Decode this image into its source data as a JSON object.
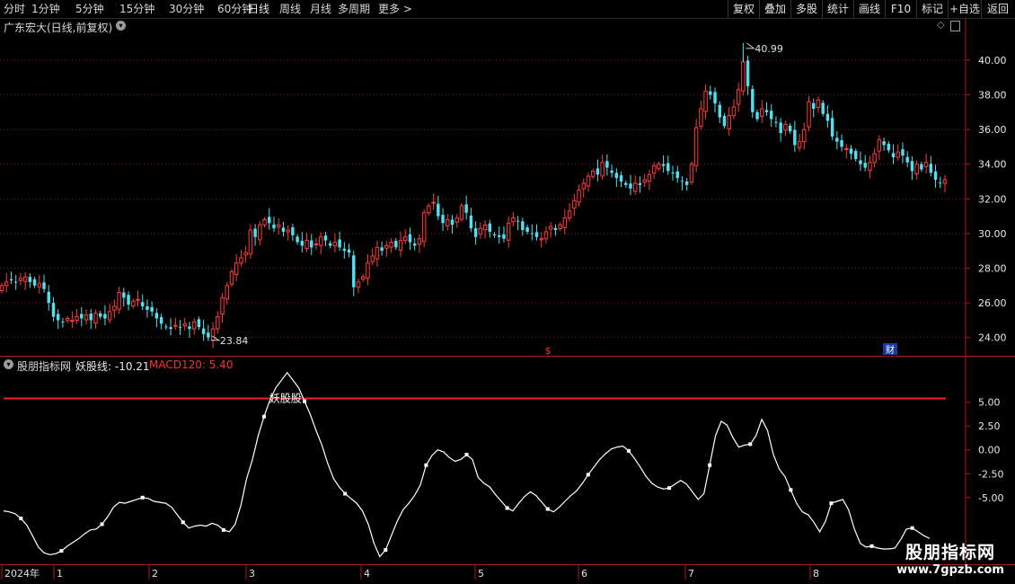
{
  "toolbar": {
    "periods": [
      "分时",
      "1分钟",
      "5分钟",
      "15分钟",
      "30分钟",
      "60分钟",
      "日线",
      "周线",
      "月线",
      "多周期",
      "更多 >"
    ],
    "active_period": "日线",
    "right_buttons": [
      "复权",
      "叠加",
      "多股",
      "统计",
      "画线",
      "F10",
      "标记",
      "+自选",
      "返回"
    ]
  },
  "main_chart": {
    "title": "广东宏大(日线,前复权)",
    "high_label": "40.99",
    "low_label": "23.84",
    "markers": [
      "$",
      "财"
    ]
  },
  "indicator": {
    "name": "股朋指标网",
    "line_label": "妖股线: -10.21",
    "macd_label": "MACD120: 5.40",
    "signal_text": "妖股股"
  },
  "watermark": {
    "title": "股朋指标网",
    "url": "www.7gpzb.com"
  },
  "colors": {
    "up": "#ff3b3b",
    "down": "#52e0f0",
    "axis": "#b01818",
    "threshold": "#ff2020",
    "line": "#ffffff"
  },
  "chart_data": [
    {
      "type": "candlestick",
      "title": "广东宏大(日线,前复权)",
      "ylim": [
        23,
        41.5
      ],
      "yticks": [
        24.0,
        26.0,
        28.0,
        30.0,
        32.0,
        34.0,
        36.0,
        38.0,
        40.0
      ],
      "ytick_labels": [
        "24.00",
        "26.00",
        "28.00",
        "30.00",
        "32.00",
        "34.00",
        "36.00",
        "38.00",
        "40.00"
      ],
      "x_labels": [
        "2024年",
        "1",
        "2",
        "3",
        "4",
        "5",
        "6",
        "7",
        "8"
      ],
      "close": [
        27.0,
        27.2,
        27.3,
        27.2,
        27.4,
        27.5,
        27.2,
        27.0,
        27.1,
        26.8,
        26.0,
        25.2,
        25.0,
        24.9,
        25.1,
        25.0,
        25.2,
        25.1,
        25.3,
        25.0,
        25.4,
        25.2,
        25.1,
        25.5,
        25.8,
        26.6,
        26.3,
        25.9,
        26.1,
        26.2,
        25.8,
        25.6,
        25.5,
        25.1,
        24.8,
        24.6,
        24.5,
        24.7,
        24.6,
        24.8,
        24.5,
        24.9,
        24.6,
        24.2,
        24.0,
        24.5,
        25.2,
        26.3,
        27.0,
        27.8,
        28.3,
        28.6,
        28.9,
        30.2,
        29.8,
        30.5,
        30.8,
        30.6,
        30.3,
        30.5,
        30.1,
        30.2,
        29.9,
        29.5,
        29.3,
        29.6,
        29.2,
        29.4,
        29.8,
        29.6,
        29.3,
        29.5,
        29.2,
        29.0,
        28.9,
        26.9,
        27.2,
        27.5,
        28.3,
        28.7,
        29.2,
        29.0,
        29.3,
        29.5,
        29.2,
        29.6,
        29.8,
        29.5,
        29.3,
        29.7,
        31.2,
        31.6,
        31.8,
        31.0,
        30.6,
        30.8,
        30.5,
        30.9,
        31.6,
        31.2,
        30.3,
        29.8,
        30.3,
        30.5,
        30.1,
        29.9,
        29.8,
        29.7,
        30.6,
        30.9,
        30.7,
        30.2,
        30.1,
        30.0,
        29.8,
        29.7,
        30.1,
        30.4,
        30.2,
        30.5,
        30.9,
        31.3,
        31.9,
        32.5,
        32.9,
        33.3,
        33.6,
        33.4,
        34.1,
        33.8,
        33.5,
        33.2,
        33.0,
        32.8,
        32.6,
        32.9,
        32.8,
        33.1,
        33.4,
        33.9,
        34.0,
        33.9,
        33.6,
        33.5,
        33.2,
        33.0,
        32.8,
        34.0,
        36.1,
        37.2,
        38.2,
        38.0,
        37.5,
        36.7,
        36.2,
        36.8,
        37.3,
        38.3,
        39.9,
        38.5,
        37.0,
        36.6,
        37.2,
        37.0,
        36.6,
        36.4,
        35.8,
        36.3,
        35.9,
        35.1,
        35.3,
        36.0,
        37.6,
        37.2,
        37.7,
        36.9,
        36.5,
        35.6,
        35.3,
        35.0,
        34.9,
        34.6,
        34.3,
        34.0,
        33.8,
        34.1,
        34.6,
        35.4,
        35.1,
        34.8,
        34.4,
        34.7,
        34.5,
        34.1,
        33.6,
        34.0,
        33.7,
        34.1,
        33.5,
        33.1,
        32.9,
        33.1
      ],
      "highs": [
        {
          "label": "40.99",
          "value": 40.99
        }
      ],
      "lows": [
        {
          "label": "23.84",
          "value": 23.84
        }
      ]
    },
    {
      "type": "line",
      "ylim": [
        -12,
        9.5
      ],
      "yticks": [
        5.0,
        2.5,
        0.0,
        -2.5,
        -5.0
      ],
      "ytick_labels": [
        "5.00",
        "2.50",
        "0.00",
        "-2.50",
        "-5.00",
        "-7.50"
      ],
      "threshold": 5.4,
      "values": [
        -6.4,
        -6.5,
        -6.7,
        -7.2,
        -7.9,
        -9.0,
        -10.2,
        -10.8,
        -11.0,
        -10.9,
        -10.6,
        -10.1,
        -9.7,
        -9.3,
        -8.8,
        -8.4,
        -8.3,
        -7.8,
        -7.0,
        -6.0,
        -5.5,
        -5.6,
        -5.4,
        -5.2,
        -5.0,
        -5.1,
        -5.4,
        -5.5,
        -5.6,
        -6.0,
        -6.8,
        -7.6,
        -8.2,
        -8.0,
        -7.9,
        -8.0,
        -7.7,
        -7.9,
        -8.4,
        -8.6,
        -7.8,
        -5.8,
        -3.0,
        -1.0,
        1.5,
        3.5,
        5.2,
        6.5,
        7.3,
        8.1,
        7.3,
        6.5,
        5.1,
        3.7,
        2.0,
        0.5,
        -1.4,
        -3.0,
        -3.9,
        -4.6,
        -5.1,
        -5.6,
        -6.4,
        -7.8,
        -9.8,
        -11.2,
        -10.5,
        -9.0,
        -7.5,
        -6.3,
        -5.6,
        -4.8,
        -3.7,
        -1.6,
        -0.6,
        0.0,
        -0.2,
        -0.8,
        -1.2,
        -1.0,
        -0.5,
        -1.0,
        -2.9,
        -3.5,
        -3.9,
        -4.7,
        -5.4,
        -6.1,
        -6.4,
        -5.6,
        -4.9,
        -4.4,
        -4.8,
        -5.5,
        -6.2,
        -6.5,
        -6.0,
        -5.4,
        -4.8,
        -4.3,
        -3.5,
        -2.6,
        -1.8,
        -1.0,
        -0.4,
        0.1,
        0.3,
        0.4,
        -0.1,
        -0.9,
        -1.8,
        -2.8,
        -3.5,
        -3.9,
        -4.1,
        -4.0,
        -3.6,
        -3.2,
        -3.6,
        -4.4,
        -5.2,
        -4.6,
        -1.6,
        1.5,
        3.0,
        2.6,
        1.3,
        0.3,
        0.5,
        0.6,
        1.5,
        3.2,
        2.0,
        -0.5,
        -2.0,
        -2.8,
        -4.2,
        -5.6,
        -6.5,
        -6.8,
        -7.6,
        -8.6,
        -7.5,
        -5.6,
        -5.4,
        -5.2,
        -6.3,
        -8.3,
        -9.8,
        -10.2,
        -10.1,
        -10.3,
        -10.4,
        -10.4,
        -10.3,
        -9.4,
        -8.3,
        -8.2,
        -8.6,
        -9.0,
        -9.3
      ]
    }
  ]
}
